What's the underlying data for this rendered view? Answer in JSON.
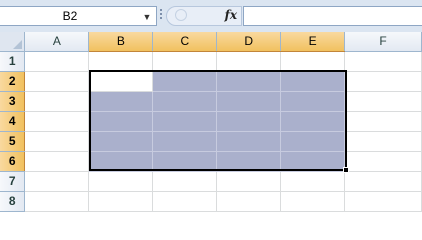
{
  "formula_bar": {
    "name_box": "B2",
    "name_box_arrow": "▼",
    "fx_label": "fx",
    "formula": ""
  },
  "columns": [
    "A",
    "B",
    "C",
    "D",
    "E",
    "F"
  ],
  "rows": [
    "1",
    "2",
    "3",
    "4",
    "5",
    "6",
    "7",
    "8"
  ],
  "selection": {
    "range": "B2:E6",
    "active_cell": "B2",
    "selected_columns": [
      "B",
      "C",
      "D",
      "E"
    ],
    "selected_rows": [
      "2",
      "3",
      "4",
      "5",
      "6"
    ]
  },
  "colors": {
    "selected_fill": "#aab0cc",
    "header_selected": "#f1c15f",
    "header_normal": "#e3e9f2"
  }
}
